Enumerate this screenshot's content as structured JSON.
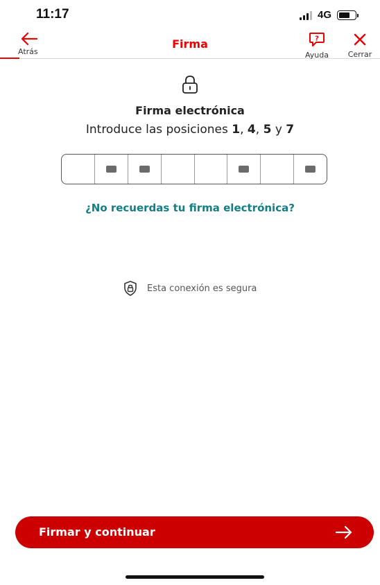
{
  "status_bar": {
    "time": "11:17",
    "network": "4G",
    "signal_bars_active": 3,
    "battery_level_percent": 70
  },
  "nav": {
    "back_label": "Atrás",
    "title": "Firma",
    "help_label": "Ayuda",
    "close_label": "Cerrar",
    "accent_color": "#ec0000"
  },
  "main": {
    "heading": "Firma electrónica",
    "instruction_prefix": "Introduce las posiciones",
    "positions": [
      "1",
      "4",
      "5",
      "7"
    ],
    "sep_comma": ",",
    "sep_and": "y",
    "pin_cells": [
      {
        "position": 1,
        "required": false
      },
      {
        "position": 2,
        "required": true
      },
      {
        "position": 3,
        "required": true
      },
      {
        "position": 4,
        "required": false
      },
      {
        "position": 5,
        "required": false
      },
      {
        "position": 6,
        "required": true
      },
      {
        "position": 7,
        "required": false
      },
      {
        "position": 8,
        "required": true
      }
    ],
    "forgot_link": "¿No recuerdas tu firma electrónica?",
    "secure_text": "Esta conexión es segura"
  },
  "footer": {
    "primary_button": "Firmar y continuar",
    "button_color": "#cc0000"
  },
  "icons": {
    "back": "arrow-left-icon",
    "help": "question-bubble-icon",
    "close": "close-icon",
    "lock": "padlock-icon",
    "shield": "shield-lock-icon",
    "continue": "arrow-right-icon"
  }
}
